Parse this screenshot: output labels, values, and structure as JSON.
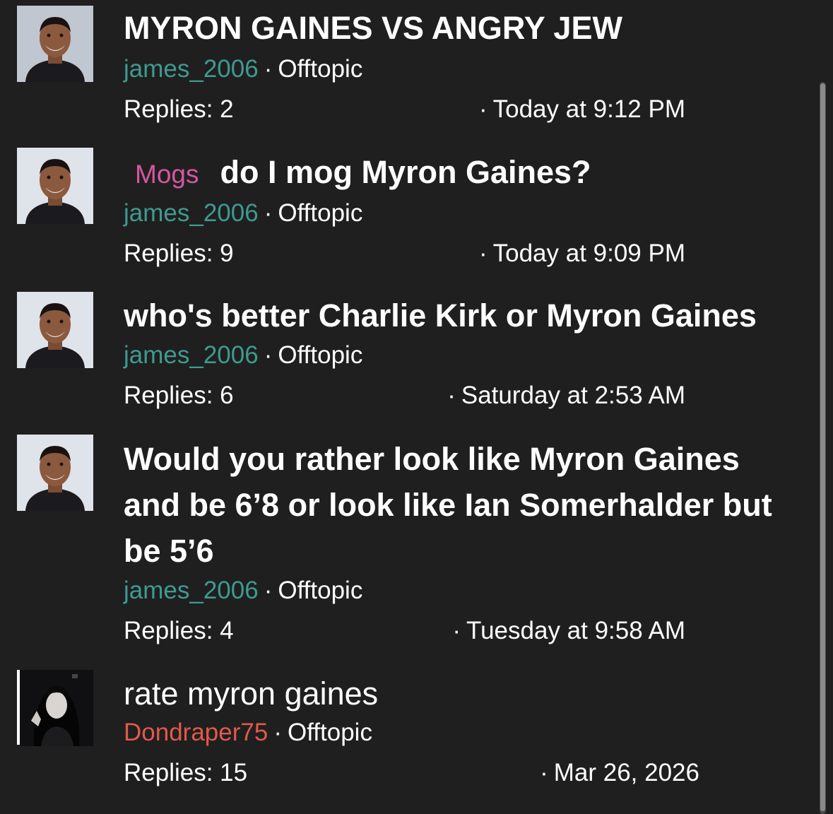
{
  "threads": [
    {
      "title": "MYRON GAINES VS ANGRY JEW",
      "prefix": "",
      "author": "james_2006",
      "forum": "Offtopic",
      "replies": "Replies: 2",
      "date": "Today at 9:12 PM",
      "avatar": "man-avatar"
    },
    {
      "title": "do I mog Myron Gaines?",
      "prefix": "Mogs",
      "author": "james_2006",
      "forum": "Offtopic",
      "replies": "Replies: 9",
      "date": "Today at 9:09 PM",
      "avatar": "man-avatar"
    },
    {
      "title": "who's better Charlie Kirk or Myron Gaines",
      "prefix": "",
      "author": "james_2006",
      "forum": "Offtopic",
      "replies": "Replies: 6",
      "date": "Saturday at 2:53 AM",
      "avatar": "man-avatar"
    },
    {
      "title_lines": [
        "Would you rather look like Myron Gaines",
        "and be 6’8 or look like Ian Somerhalder but",
        "be 5’6"
      ],
      "prefix": "",
      "author": "james_2006",
      "forum": "Offtopic",
      "replies": "Replies: 4",
      "date": "Tuesday at 9:58 AM",
      "avatar": "man-avatar"
    },
    {
      "title": "rate myron gaines",
      "prefix": "",
      "author": "Dondraper75",
      "forum": "Offtopic",
      "replies": "Replies: 15",
      "date": "Mar 26, 2026",
      "avatar": "woman-avatar"
    }
  ],
  "separator": "·",
  "colors": {
    "background": "#1f1f20",
    "author_teal": "#3f9a8f",
    "author_red": "#e2594a",
    "prefix_pink": "#d4589f"
  }
}
